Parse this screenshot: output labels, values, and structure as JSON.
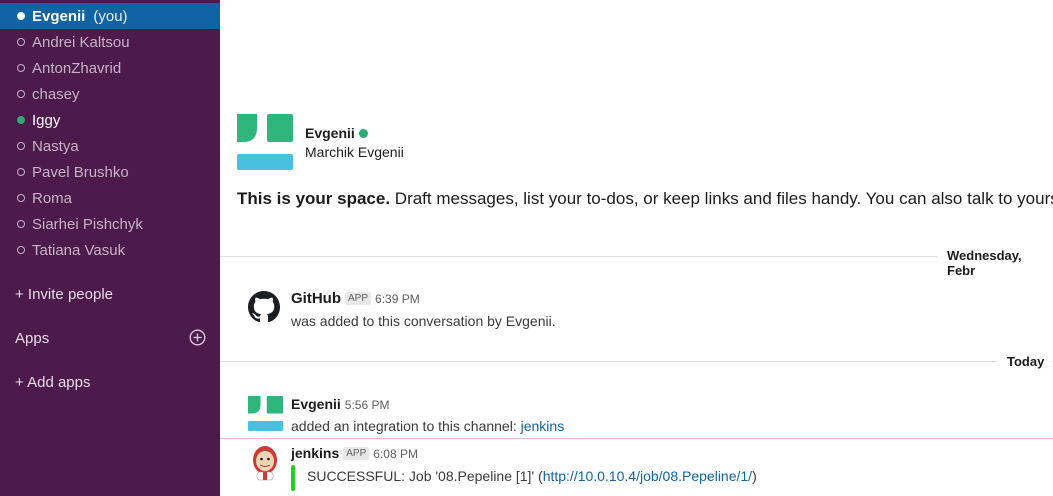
{
  "sidebar": {
    "direct_messages": [
      {
        "name": "Evgenii",
        "suffix": "(you)"
      },
      {
        "name": "Andrei Kaltsou"
      },
      {
        "name": "AntonZhavrid"
      },
      {
        "name": "chasey"
      },
      {
        "name": "Iggy"
      },
      {
        "name": "Nastya"
      },
      {
        "name": "Pavel Brushko"
      },
      {
        "name": "Roma"
      },
      {
        "name": "Siarhei Pishchyk"
      },
      {
        "name": "Tatiana Vasuk"
      }
    ],
    "invite_label": "+ Invite people",
    "apps_heading": "Apps",
    "add_apps_label": "+ Add apps"
  },
  "intro": {
    "name": "Evgenii",
    "full_name": "Marchik Evgenii",
    "bold_text": "This is your space.",
    "text": " Draft messages, list your to-dos, or keep links and files handy. You can also talk to yours"
  },
  "dividers": {
    "first": "Wednesday, Febr",
    "second": "Today"
  },
  "messages": [
    {
      "author": "GitHub",
      "badge": "APP",
      "time": "6:39 PM",
      "text": "was added to this conversation by Evgenii."
    },
    {
      "author": "Evgenii",
      "time": "5:56 PM",
      "text": "added an integration to this channel: ",
      "link": "jenkins"
    },
    {
      "author": "jenkins",
      "badge": "APP",
      "time": "6:08 PM",
      "text_before": "SUCCESSFUL: Job '08.Pepeline [1]' (",
      "link": "http://10.0.10.4/job/08.Pepeline/1/",
      "text_after": ")"
    }
  ],
  "colors": {
    "sidebar_bg": "#4d1a4c",
    "active_bg": "#1164a3",
    "presence": "#2bac76",
    "logo_green": "#2eb67d",
    "logo_blue": "#4ac0e0",
    "success_bar": "#1bd41b",
    "link": "#1264a3"
  }
}
